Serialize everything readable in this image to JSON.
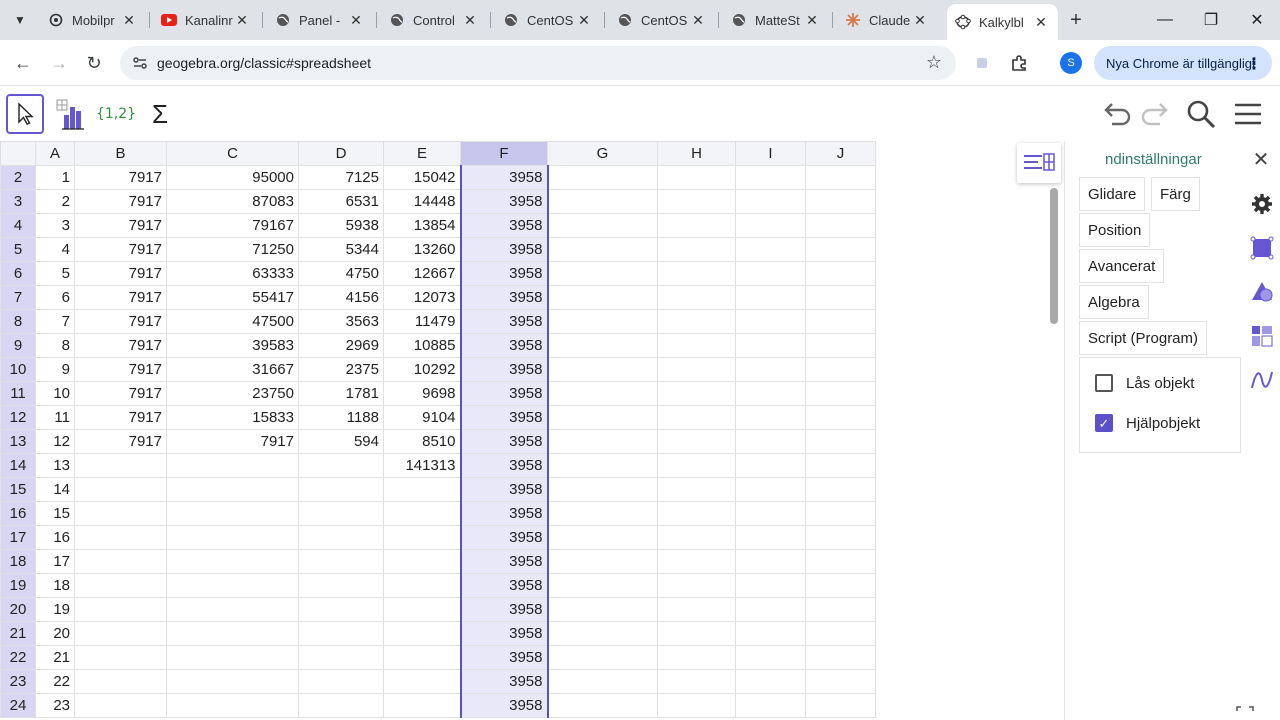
{
  "browser": {
    "tabs": [
      {
        "title": "Mobilpr",
        "favicon": "openai-icon"
      },
      {
        "title": "Kanalinr",
        "favicon": "youtube-icon"
      },
      {
        "title": "Panel - ",
        "favicon": "globe-icon"
      },
      {
        "title": "Control",
        "favicon": "globe-icon"
      },
      {
        "title": "CentOS",
        "favicon": "globe-icon"
      },
      {
        "title": "CentOS",
        "favicon": "globe-icon"
      },
      {
        "title": "MatteSt",
        "favicon": "globe-icon"
      },
      {
        "title": "Claude",
        "favicon": "claude-icon"
      },
      {
        "title": "Kalkylbl",
        "favicon": "geogebra-icon"
      }
    ],
    "active_tab": 8,
    "url": "geogebra.org/classic#spreadsheet",
    "update_label": "Nya Chrome är tillgängligt",
    "profile_initial": "S"
  },
  "ggb_toolbar": {
    "list_tool_label": "{1,2}",
    "sum_tool_label": "Σ"
  },
  "spreadsheet": {
    "columns": [
      "A",
      "B",
      "C",
      "D",
      "E",
      "F",
      "G",
      "H",
      "I",
      "J"
    ],
    "selected_column": "F",
    "rows": [
      {
        "n": "2",
        "A": "1",
        "B": "7917",
        "C": "95000",
        "D": "7125",
        "E": "15042",
        "F": "3958"
      },
      {
        "n": "3",
        "A": "2",
        "B": "7917",
        "C": "87083",
        "D": "6531",
        "E": "14448",
        "F": "3958"
      },
      {
        "n": "4",
        "A": "3",
        "B": "7917",
        "C": "79167",
        "D": "5938",
        "E": "13854",
        "F": "3958"
      },
      {
        "n": "5",
        "A": "4",
        "B": "7917",
        "C": "71250",
        "D": "5344",
        "E": "13260",
        "F": "3958"
      },
      {
        "n": "6",
        "A": "5",
        "B": "7917",
        "C": "63333",
        "D": "4750",
        "E": "12667",
        "F": "3958"
      },
      {
        "n": "7",
        "A": "6",
        "B": "7917",
        "C": "55417",
        "D": "4156",
        "E": "12073",
        "F": "3958"
      },
      {
        "n": "8",
        "A": "7",
        "B": "7917",
        "C": "47500",
        "D": "3563",
        "E": "11479",
        "F": "3958"
      },
      {
        "n": "9",
        "A": "8",
        "B": "7917",
        "C": "39583",
        "D": "2969",
        "E": "10885",
        "F": "3958"
      },
      {
        "n": "10",
        "A": "9",
        "B": "7917",
        "C": "31667",
        "D": "2375",
        "E": "10292",
        "F": "3958"
      },
      {
        "n": "11",
        "A": "10",
        "B": "7917",
        "C": "23750",
        "D": "1781",
        "E": "9698",
        "F": "3958"
      },
      {
        "n": "12",
        "A": "11",
        "B": "7917",
        "C": "15833",
        "D": "1188",
        "E": "9104",
        "F": "3958"
      },
      {
        "n": "13",
        "A": "12",
        "B": "7917",
        "C": "7917",
        "D": "594",
        "E": "8510",
        "F": "3958"
      },
      {
        "n": "14",
        "A": "13",
        "B": "",
        "C": "",
        "D": "",
        "E": "141313",
        "F": "3958"
      },
      {
        "n": "15",
        "A": "14",
        "B": "",
        "C": "",
        "D": "",
        "E": "",
        "F": "3958"
      },
      {
        "n": "16",
        "A": "15",
        "B": "",
        "C": "",
        "D": "",
        "E": "",
        "F": "3958"
      },
      {
        "n": "17",
        "A": "16",
        "B": "",
        "C": "",
        "D": "",
        "E": "",
        "F": "3958"
      },
      {
        "n": "18",
        "A": "17",
        "B": "",
        "C": "",
        "D": "",
        "E": "",
        "F": "3958"
      },
      {
        "n": "19",
        "A": "18",
        "B": "",
        "C": "",
        "D": "",
        "E": "",
        "F": "3958"
      },
      {
        "n": "20",
        "A": "19",
        "B": "",
        "C": "",
        "D": "",
        "E": "",
        "F": "3958"
      },
      {
        "n": "21",
        "A": "20",
        "B": "",
        "C": "",
        "D": "",
        "E": "",
        "F": "3958"
      },
      {
        "n": "22",
        "A": "21",
        "B": "",
        "C": "",
        "D": "",
        "E": "",
        "F": "3958"
      },
      {
        "n": "23",
        "A": "22",
        "B": "",
        "C": "",
        "D": "",
        "E": "",
        "F": "3958"
      },
      {
        "n": "24",
        "A": "23",
        "B": "",
        "C": "",
        "D": "",
        "E": "",
        "F": "3958"
      }
    ]
  },
  "properties": {
    "title": "ndinställningar",
    "tabs": [
      "Glidare",
      "Färg",
      "Position",
      "Avancerat",
      "Algebra",
      "Script (Program)"
    ],
    "checkboxes": [
      {
        "label": "Lås objekt",
        "checked": false
      },
      {
        "label": "Hjälpobjekt",
        "checked": true
      }
    ]
  },
  "colors": {
    "accent": "#5b50c9",
    "row_header": "#d8d6f3",
    "selected_column_fill": "#e9e8f9",
    "title_green": "#2e7d6b"
  }
}
